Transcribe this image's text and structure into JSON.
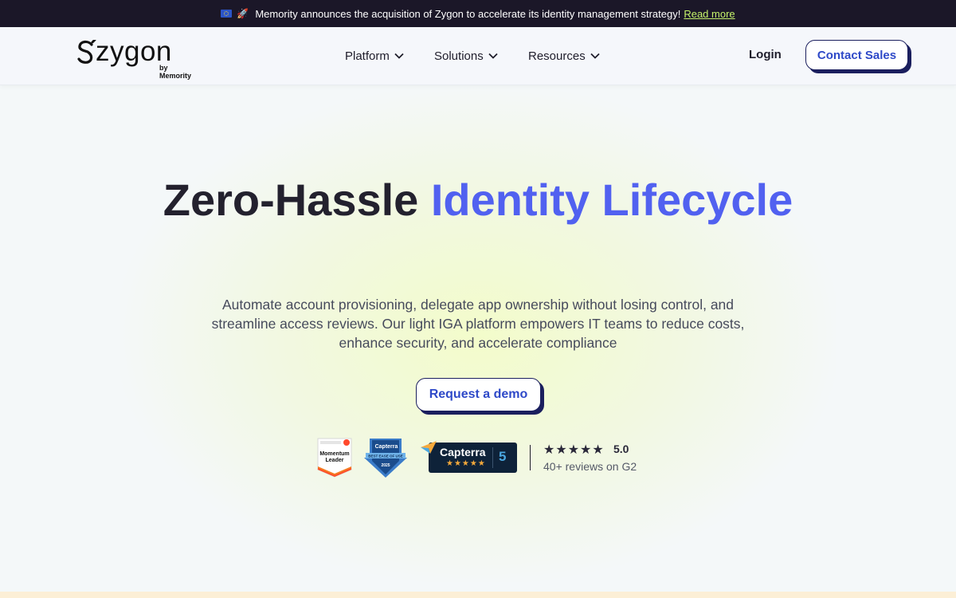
{
  "announcement": {
    "text": "Memority announces the acquisition of Zygon to accelerate its identity management strategy!",
    "link_label": "Read more"
  },
  "brand": {
    "logo_text": "zygon",
    "logo_subtext": "by Memority"
  },
  "nav": {
    "items": [
      {
        "label": "Platform"
      },
      {
        "label": "Solutions"
      },
      {
        "label": "Resources"
      }
    ],
    "login_label": "Login",
    "contact_label": "Contact Sales"
  },
  "hero": {
    "title_part1": "Zero-Hassle",
    "title_accent": "Identity Lifecycle",
    "subtitle": "Automate account provisioning, delegate app ownership without losing control, and streamline access reviews. Our light IGA platform empowers IT teams to reduce costs, enhance security, and accelerate compliance",
    "cta_label": "Request a demo"
  },
  "badges": {
    "g2_badge": {
      "line1": "Momentum",
      "line2": "Leader"
    },
    "capterra_badge": {
      "brand": "Capterra",
      "line1": "BEST EASE OF USE",
      "year": "2025"
    },
    "capterra_rating": {
      "brand": "Capterra",
      "score": "5"
    },
    "g2_rating": {
      "stars": 5,
      "value": "5.0",
      "reviews": "40+ reviews on G2"
    }
  },
  "colors": {
    "accent": "#5161f0",
    "link_green": "#c6f36b",
    "dark_navy": "#1b1f5e",
    "button_text": "#2e49c8",
    "announcement_bg": "#1b1728"
  }
}
